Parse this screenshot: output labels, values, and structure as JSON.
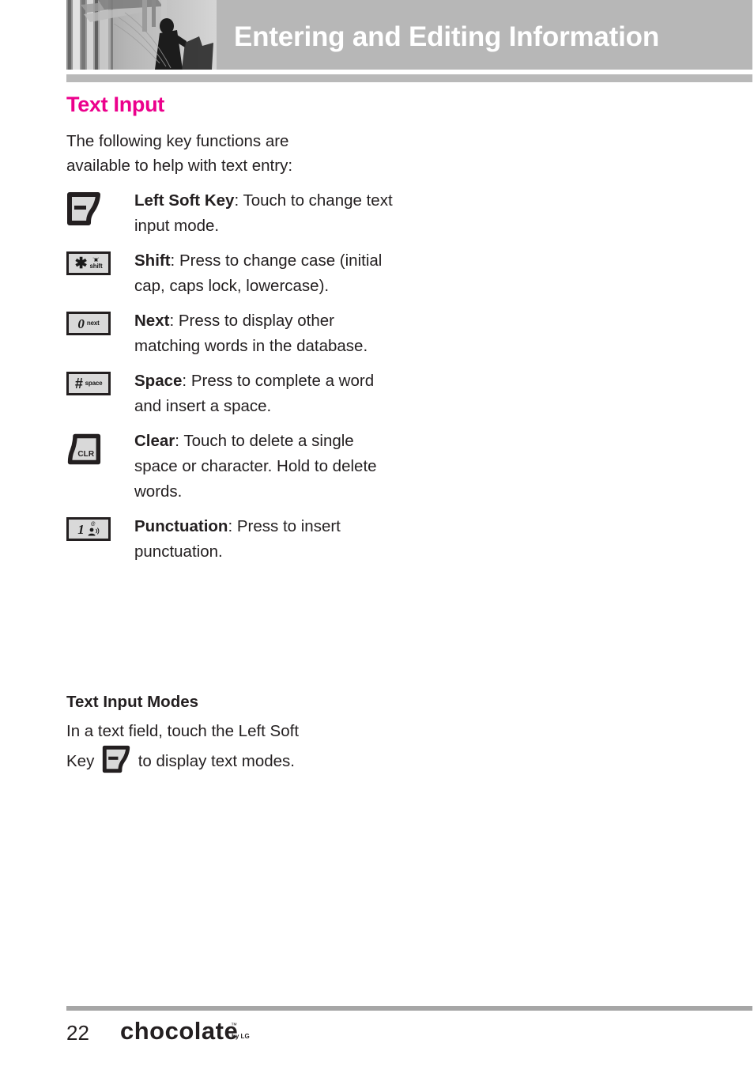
{
  "header": {
    "title": "Entering and Editing Information",
    "photo_alt": "grayscale-photo"
  },
  "section": {
    "title": "Text Input",
    "intro": "The following key functions are available to help with text entry:"
  },
  "keys": [
    {
      "icon": "left-soft-key-icon",
      "icon_type": "softkey",
      "name": "Left Soft Key",
      "separator": ": ",
      "description": "Touch to change text input mode."
    },
    {
      "icon": "shift-key-icon",
      "icon_type": "phonekey",
      "glyph": "✱",
      "sublabel": "shift",
      "tiny_top": "'▣'",
      "name": "Shift",
      "separator": ": ",
      "description": "Press to change case (initial cap, caps lock, lowercase)."
    },
    {
      "icon": "next-key-icon",
      "icon_type": "phonekey",
      "glyph": "0",
      "sublabel": "next",
      "name": "Next",
      "separator": ": ",
      "description": "Press to display other matching words in the database."
    },
    {
      "icon": "space-key-icon",
      "icon_type": "phonekey",
      "glyph": "#",
      "sublabel": "space",
      "name": "Space",
      "separator": ": ",
      "description": "Press to complete a word and insert a space."
    },
    {
      "icon": "clear-key-icon",
      "icon_type": "clearkey",
      "glyph": "CLR",
      "name": "Clear",
      "separator": ": ",
      "description": "Touch to delete a single space or character. Hold to delete words."
    },
    {
      "icon": "punctuation-key-icon",
      "icon_type": "phonekey",
      "glyph": "1",
      "sublabel": "@",
      "tiny_top": "voicemail",
      "name": "Punctuation",
      "separator": ": ",
      "description": "Press to insert punctuation."
    }
  ],
  "modes": {
    "title": "Text Input Modes",
    "line1": "In a text field, touch the Left Soft",
    "line2_prefix": "Key",
    "line2_suffix": "to display text modes."
  },
  "footer": {
    "page_number": "22",
    "brand": "chocolate",
    "trademark": "™",
    "by_line": "by LG"
  },
  "colors": {
    "accent_pink": "#ec008c",
    "header_gray": "#b7b7b7",
    "rule_gray": "#b9b9b9",
    "footer_rule_gray": "#a6a6a6",
    "text_black": "#231f20"
  }
}
